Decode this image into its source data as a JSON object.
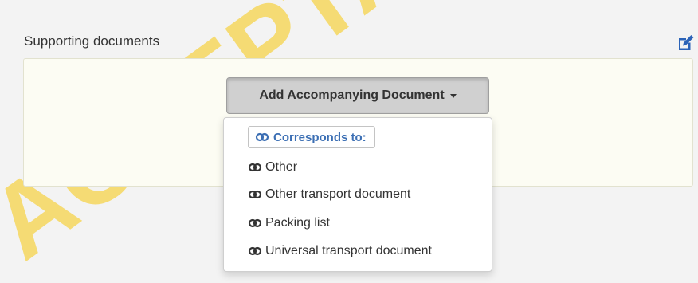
{
  "section": {
    "title": "Supporting documents",
    "edit_icon": "edit-icon"
  },
  "watermark": {
    "text": "ACCEPTANCE",
    "color": "#f6d34a"
  },
  "add_button": {
    "label": "Add Accompanying Document"
  },
  "dropdown": {
    "header": "Corresponds to:",
    "header_icon": "link-icon",
    "items": [
      {
        "label": "Other",
        "icon": "link-icon"
      },
      {
        "label": "Other transport document",
        "icon": "link-icon"
      },
      {
        "label": "Packing list",
        "icon": "link-icon"
      },
      {
        "label": "Universal transport document",
        "icon": "link-icon"
      }
    ]
  },
  "colors": {
    "header_accent": "#3c6fb4",
    "edit_icon": "#2b63b8",
    "panel_bg": "#fcfcf3"
  }
}
